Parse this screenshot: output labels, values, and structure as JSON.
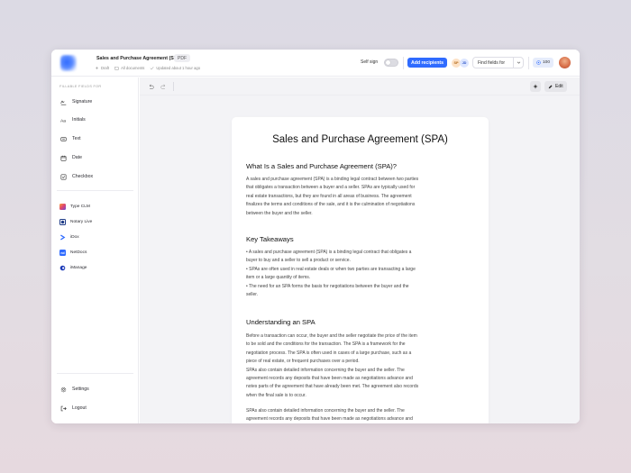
{
  "header": {
    "doc_title": "Sales and Purchase Agreement (SPA)",
    "doc_type": "PDF",
    "status": "Draft",
    "folder": "All documents",
    "updated": "Updated about 1 hour ago",
    "self_sign_label": "Self sign",
    "add_recipients_label": "Add recipients",
    "recipient_initials": [
      "SP",
      "JD"
    ],
    "find_fields_label": "Find fields for",
    "credits": "100",
    "accent": "#2f6bff"
  },
  "sidebar": {
    "section_title": "FILLABLE FIELDS FOR",
    "fields": [
      {
        "label": "Signature",
        "icon": "signature-icon"
      },
      {
        "label": "Initials",
        "icon": "initials-icon"
      },
      {
        "label": "Text",
        "icon": "text-icon"
      },
      {
        "label": "Date",
        "icon": "calendar-icon"
      },
      {
        "label": "Checkbox",
        "icon": "checkbox-icon"
      }
    ],
    "integrations": [
      {
        "label": "Type CLM",
        "color": "#e0456e"
      },
      {
        "label": "Notary Live",
        "color": "#1f3c88"
      },
      {
        "label": "iDox",
        "color": "#2f6bff"
      },
      {
        "label": "NetDocs",
        "color": "#2f6bff"
      },
      {
        "label": "iManage",
        "color": "#1d3bb8"
      }
    ],
    "settings_label": "Settings",
    "logout_label": "Logout"
  },
  "toolbar": {
    "edit_label": "Edit"
  },
  "document": {
    "title": "Sales and Purchase Agreement (SPA)",
    "sections": [
      {
        "heading": "What Is a Sales and Purchase Agreement (SPA)?",
        "lines": [
          "A sales and purchase agreement (SPA) is a binding legal contract between two parties",
          "that obligates a transaction between a buyer and a seller. SPAs are typically used for",
          "real estate transactions, but they are found in all areas of business. The agreement",
          "finalizes the terms and conditions of the sale, and it is the culmination of negotiations",
          "between the buyer and the seller."
        ]
      },
      {
        "heading": "Key Takeaways",
        "lines": [
          "• A sales and purchase agreement (SPA) is a binding legal contract that obligates a",
          "buyer to buy and a seller to sell a product or service.",
          "• SPAs are often used in real estate deals or when two parties are transacting a large",
          "item or a large quantity of items.",
          "• The need for an SPA forms the basis for negotiations between the buyer and the",
          "seller."
        ]
      },
      {
        "heading": "Understanding an SPA",
        "lines": [
          "Before a transaction can occur, the buyer and the seller negotiate the price of the item",
          "to be sold and the conditions for the transaction. The SPA is a framework for the",
          "negotiation process. The SPA is often used in cases of a large purchase, such as a",
          "piece of real estate, or frequent purchases over a period.",
          "SPAs also contain detailed information concerning the buyer and the seller. The",
          "agreement records any deposits that have been made as negotiations advance and",
          "notes parts of the agreement that have already been met. The agreement also records",
          "when the final sale is to occur."
        ],
        "lines2": [
          "SPAs also contain detailed information concerning the buyer and the seller. The",
          "agreement records any deposits that have been made as negotiations advance and"
        ]
      }
    ]
  }
}
